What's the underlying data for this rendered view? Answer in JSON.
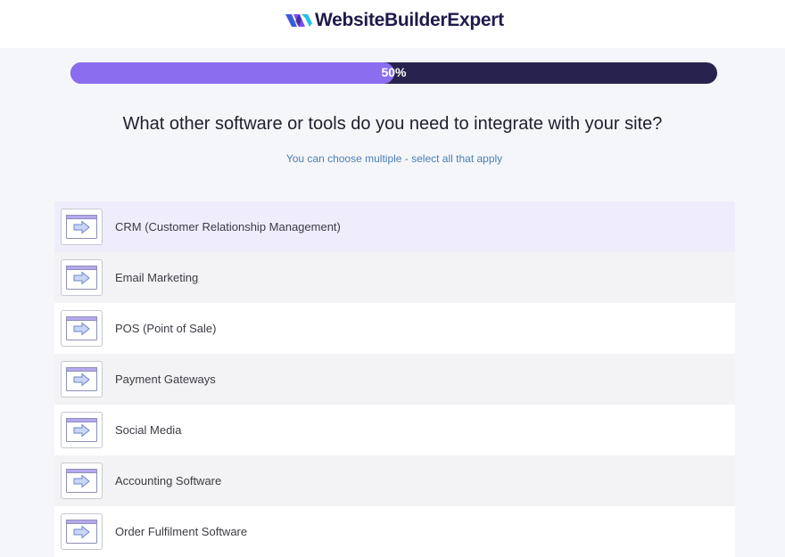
{
  "header": {
    "logo_text": "WebsiteBuilderExpert"
  },
  "progress": {
    "percent": 50,
    "label": "50%",
    "fill_color": "#8b6ef0",
    "track_color": "#28234e"
  },
  "question": {
    "title": "What other software or tools do you need to integrate with your site?",
    "subtitle": "You can choose multiple - select all that apply"
  },
  "options": [
    {
      "label": "CRM (Customer Relationship Management)",
      "icon": "browser-arrow-icon",
      "state": "hover"
    },
    {
      "label": "Email Marketing",
      "icon": "browser-arrow-icon",
      "state": "normal"
    },
    {
      "label": "POS (Point of Sale)",
      "icon": "browser-arrow-icon",
      "state": "normal"
    },
    {
      "label": "Payment Gateways",
      "icon": "browser-arrow-icon",
      "state": "normal"
    },
    {
      "label": "Social Media",
      "icon": "browser-arrow-icon",
      "state": "normal"
    },
    {
      "label": "Accounting Software",
      "icon": "browser-arrow-icon",
      "state": "normal"
    },
    {
      "label": "Order Fulfilment Software",
      "icon": "browser-arrow-icon",
      "state": "normal"
    }
  ],
  "colors": {
    "accent": "#8b6ef0",
    "brand_dark": "#1e1b4b",
    "subtitle": "#4a7fb5"
  }
}
